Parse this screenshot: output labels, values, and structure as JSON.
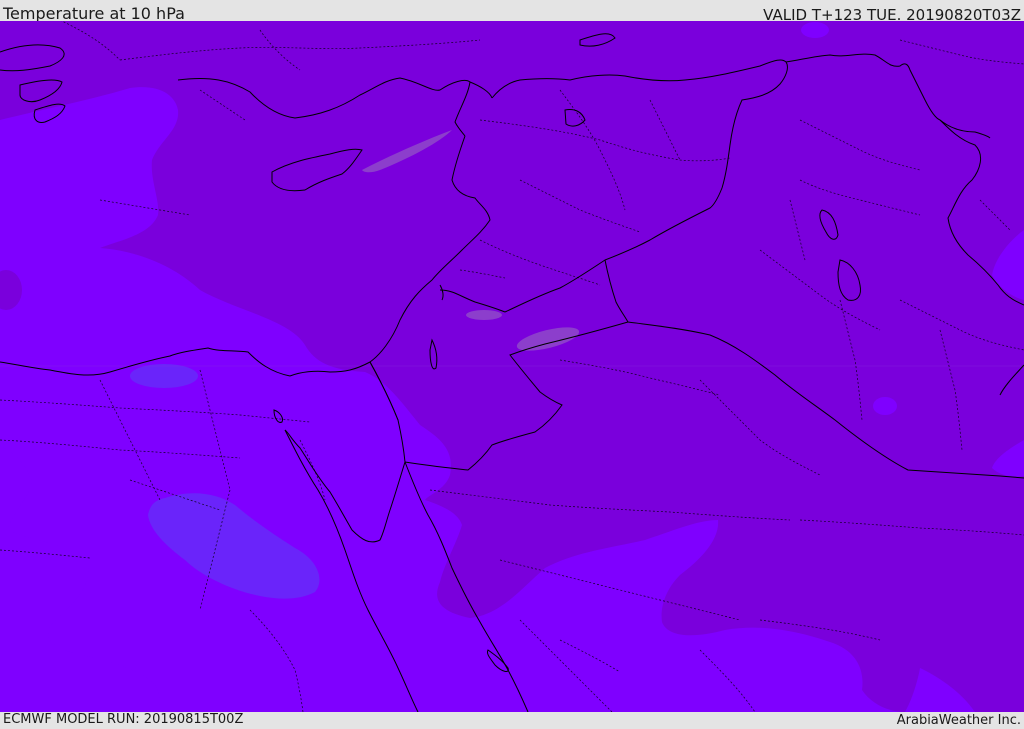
{
  "header": {
    "title": "Temperature at 10 hPa",
    "valid": "VALID T+123 TUE. 20190820T03Z"
  },
  "footer": {
    "model_run": "ECMWF MODEL RUN: 20190815T00Z",
    "credit": "ArabiaWeather Inc."
  },
  "map": {
    "field": "temperature",
    "level": "10 hPa",
    "colors": {
      "warm_band": "#7a00dc",
      "cool_band": "#7f00ff",
      "coolest_band": "#6a24fa",
      "warm_spot": "#8c3ecc",
      "border_line": "#000000"
    }
  }
}
